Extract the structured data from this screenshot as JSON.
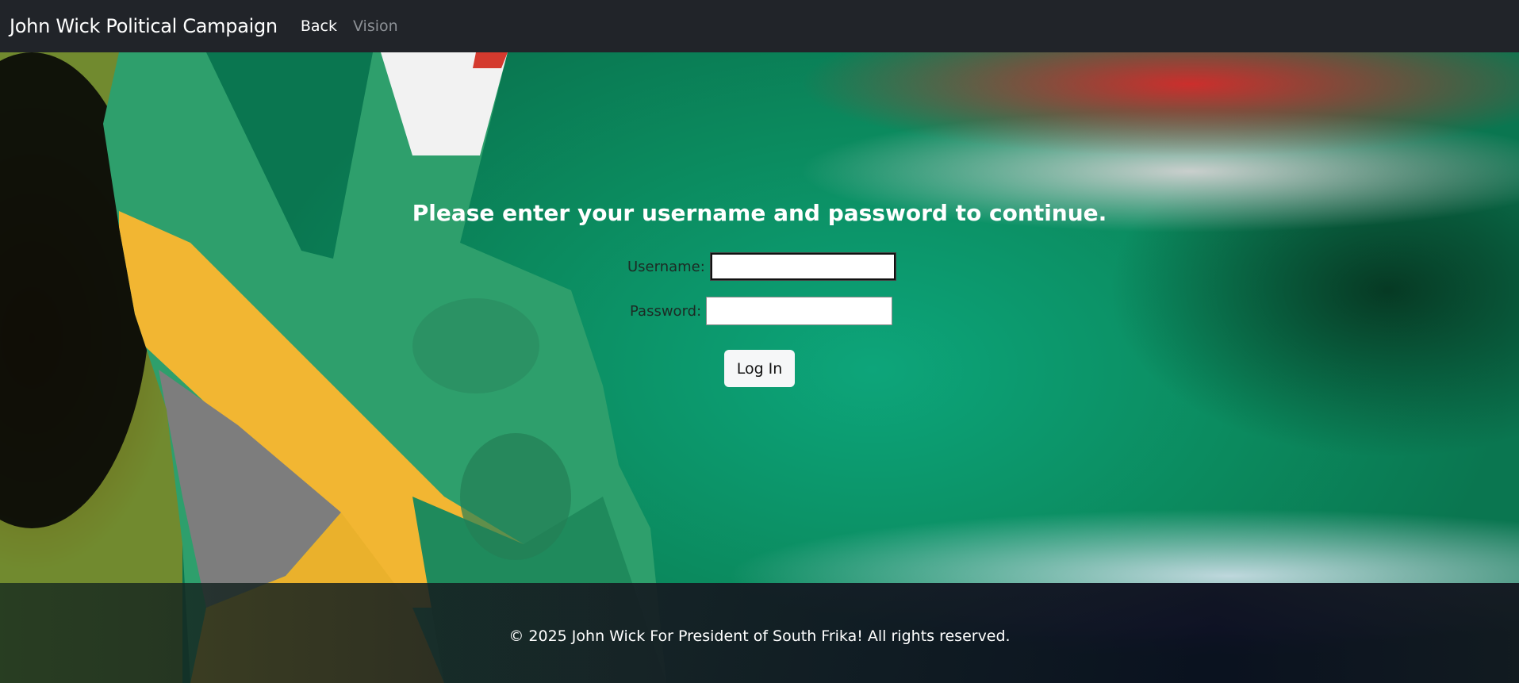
{
  "navbar": {
    "brand": "John Wick Political Campaign",
    "links": [
      {
        "label": "Back"
      },
      {
        "label": "Vision"
      }
    ]
  },
  "login": {
    "title": "Please enter your username and password to continue.",
    "username_label": "Username:",
    "username_value": "",
    "password_label": "Password:",
    "password_value": "",
    "submit_label": "Log In"
  },
  "footer": {
    "text": "© 2025 John Wick For President of South Frika! All rights reserved."
  },
  "colors": {
    "navbar": "#212429",
    "hero_green": "#0da57a",
    "flag_red": "#d62a2a",
    "flag_yellow": "#f2b632",
    "flag_blue": "#506ec8"
  }
}
